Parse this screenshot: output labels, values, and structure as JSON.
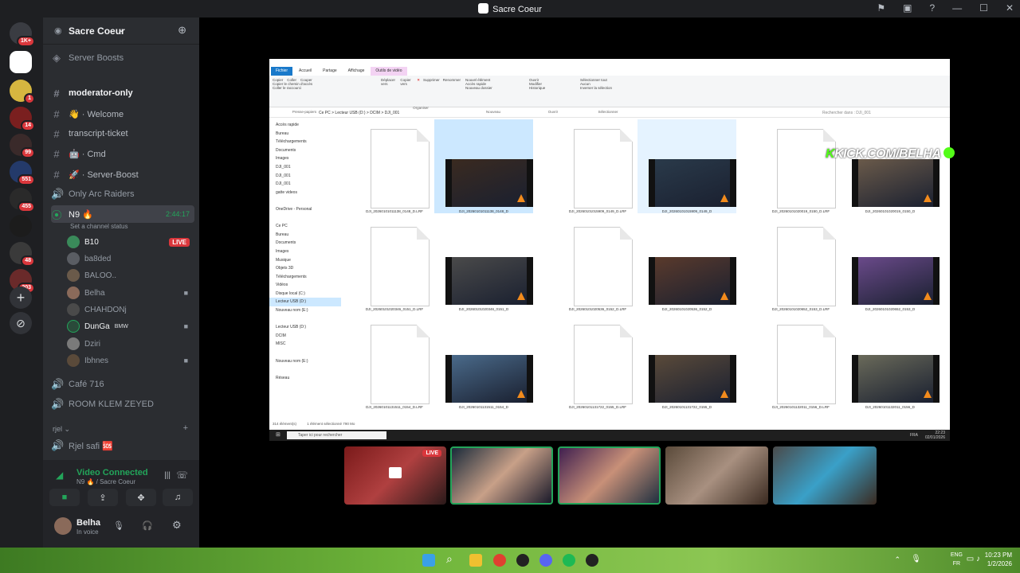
{
  "window": {
    "title": "Sacre Coeur"
  },
  "servers": [
    {
      "badge": "1K+"
    },
    {
      "badge": ""
    },
    {
      "badge": "1"
    },
    {
      "badge": "14"
    },
    {
      "badge": "99"
    },
    {
      "badge": "551"
    },
    {
      "badge": "455"
    },
    {
      "badge": "48"
    },
    {
      "badge": "203"
    }
  ],
  "guild": {
    "name": "Sacre Coeur"
  },
  "channels": {
    "boosts": "Server Boosts",
    "items": [
      {
        "name": "moderator-only",
        "bold": true
      },
      {
        "name": "👋 · Welcome"
      },
      {
        "name": "transcript-ticket"
      },
      {
        "name": "🤖 · Cmd"
      },
      {
        "name": "🚀 · Server-Boost"
      },
      {
        "name": "Only Arc Raiders"
      }
    ],
    "active_voice": {
      "name": "N9 🔥",
      "timer": "2:44:17",
      "status": "Set a channel status"
    },
    "voice_users": [
      {
        "name": "B10",
        "live": "LIVE"
      },
      {
        "name": "ba8ded"
      },
      {
        "name": "BALOO.."
      },
      {
        "name": "Belha"
      },
      {
        "name": "CHAHDONj"
      },
      {
        "name": "DunGa",
        "tag": "BMW"
      },
      {
        "name": "Dziri"
      },
      {
        "name": "Ibhnes"
      }
    ],
    "other_voice": [
      "Café 716",
      "ROOM KLEM ZEYED"
    ],
    "category": "rjel",
    "rjel_channel": "Rjel safi 🆘"
  },
  "voice_panel": {
    "status": "Video Connected",
    "location": "N9 🔥 / Sacre Coeur"
  },
  "user": {
    "name": "Belha",
    "status": "In voice"
  },
  "explorer": {
    "tabs": [
      "Fichier",
      "Accueil",
      "Partage",
      "Affichage",
      "Outils de vidéo"
    ],
    "ribbon": {
      "presse": [
        "Épingler à Accès rapide",
        "Copier",
        "Coller",
        "Couper",
        "Copier le chemin d'accès",
        "Coller le raccourci"
      ],
      "presse_label": "Presse-papiers",
      "organiser": [
        "Déplacer vers",
        "Copier vers",
        "Supprimer",
        "Renommer"
      ],
      "organiser_label": "Organiser",
      "nouveau": [
        "Nouveau dossier",
        "Nouvel élément",
        "Accès rapide"
      ],
      "nouveau_label": "Nouveau",
      "ouvrir": [
        "Propriétés",
        "Ouvrir",
        "Modifier",
        "Historique"
      ],
      "ouvrir_label": "Ouvrir",
      "selection": [
        "Sélectionner tout",
        "Aucun",
        "Inverser la sélection"
      ],
      "selection_label": "Sélectionner"
    },
    "path": "Ce PC  >  Lecteur USB (D:)  >  DCIM  >  DJI_001",
    "search_placeholder": "Rechercher dans : DJI_001",
    "nav": [
      "Accès rapide",
      "Bureau",
      "Téléchargements",
      "Documents",
      "Images",
      "DJI_001",
      "DJI_001",
      "DJI_001",
      "gatte videos",
      "",
      "OneDrive - Personal",
      "",
      "Ce PC",
      "Bureau",
      "Documents",
      "Images",
      "Musique",
      "Objets 3D",
      "Téléchargements",
      "Vidéos",
      "Disque local (C:)",
      "Lecteur USB (D:)",
      "Nouveau nom (E:)",
      "",
      "Lecteur USB (D:)",
      "DCIM",
      "MISC",
      "",
      "Nouveau nom (E:)",
      "",
      "Réseau"
    ],
    "files": [
      {
        "name": "DJI_20260101011138_0148_D.LRF",
        "type": "doc"
      },
      {
        "name": "DJI_20260101011138_0148_D",
        "type": "vid",
        "state": "sel"
      },
      {
        "name": "DJI_20260101015909_0149_D.LRF",
        "type": "doc"
      },
      {
        "name": "DJI_20260101015909_0149_D",
        "type": "vid",
        "state": "hl"
      },
      {
        "name": "DJI_20260101020019_0150_D.LRF",
        "type": "doc"
      },
      {
        "name": "DJI_20260101020019_0150_D",
        "type": "vid"
      },
      {
        "name": "DJI_20260101020346_0151_D.LRF",
        "type": "doc"
      },
      {
        "name": "DJI_20260101020346_0151_D",
        "type": "vid"
      },
      {
        "name": "DJI_20260101020536_0152_D.LRF",
        "type": "doc"
      },
      {
        "name": "DJI_20260101020536_0152_D",
        "type": "vid"
      },
      {
        "name": "DJI_20260101020652_0153_D.LRF",
        "type": "doc"
      },
      {
        "name": "DJI_20260101020652_0153_D",
        "type": "vid"
      },
      {
        "name": "DJI_20260101131511_0154_D.LRF",
        "type": "doc"
      },
      {
        "name": "DJI_20260101131511_0154_D",
        "type": "vid"
      },
      {
        "name": "DJI_20260101131722_0155_D.LRF",
        "type": "doc"
      },
      {
        "name": "DJI_20260101131722_0155_D",
        "type": "vid"
      },
      {
        "name": "DJI_20260101132011_0156_D.LRF",
        "type": "doc"
      },
      {
        "name": "DJI_20260101132011_0156_D",
        "type": "vid"
      }
    ],
    "status_items": "314 élément(s)",
    "status_selected": "1 élément sélectionné 790 Mo",
    "taskbar_search": "Taper ici pour rechercher",
    "taskbar_clock": "22:23",
    "taskbar_date": "02/01/2026",
    "taskbar_lang": "FRA"
  },
  "overlay": {
    "kick_k": "K",
    "kick_text": "KICK.COM/BELHA"
  },
  "stream_tiles": [
    {
      "live": "LIVE"
    }
  ],
  "taskbar": {
    "lang": "ENG",
    "lang2": "FR",
    "time": "10:23 PM",
    "date": "1/2/2026"
  },
  "colors": {
    "discord_bg": "#2b2d31",
    "live": "#da373c",
    "online": "#23a55a",
    "kick": "#53fc18"
  }
}
